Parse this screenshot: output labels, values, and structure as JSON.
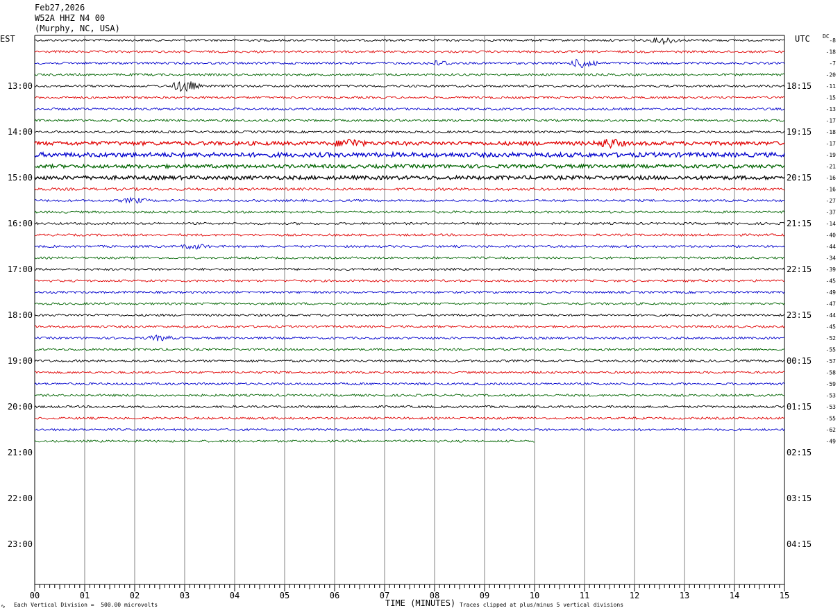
{
  "header": {
    "date": "Feb27,2026",
    "station": "W52A HHZ N4 00",
    "location": "(Murphy, NC, USA)"
  },
  "labels": {
    "left_tz": "EST",
    "right_tz": "UTC",
    "dc": "DC",
    "xlabel": "TIME (MINUTES)",
    "scale_note": "Each Vertical Division =  500.00 microvolts",
    "clip_note": "Traces clipped at plus/minus 5 vertical divisions",
    "corner_mark": "∿"
  },
  "chart_data": {
    "type": "line",
    "title": "W52A HHZ N4 00",
    "xlabel": "TIME (MINUTES)",
    "ylabel": "",
    "x_range": [
      0,
      15
    ],
    "x_ticks": [
      "00",
      "01",
      "02",
      "03",
      "04",
      "05",
      "06",
      "07",
      "08",
      "09",
      "10",
      "11",
      "12",
      "13",
      "14",
      "15"
    ],
    "lines_per_hour": 4,
    "total_lines": 48,
    "left_hour_labels": [
      "13:00",
      "14:00",
      "15:00",
      "16:00",
      "17:00",
      "18:00",
      "19:00",
      "20:00",
      "21:00",
      "22:00",
      "23:00"
    ],
    "right_hour_labels": [
      "18:15",
      "19:15",
      "20:15",
      "21:15",
      "22:15",
      "23:15",
      "00:15",
      "01:15",
      "02:15",
      "03:15",
      "04:15"
    ],
    "trace_colors": [
      "#000000",
      "#e00000",
      "#0000cc",
      "#006400"
    ],
    "dc_offsets": [
      -8,
      -18,
      -7,
      -20,
      -11,
      -15,
      -13,
      -17,
      -18,
      -17,
      -19,
      -21,
      -16,
      -16,
      -27,
      -37,
      -14,
      -40,
      -44,
      -34,
      -39,
      -45,
      -49,
      -47,
      -44,
      -45,
      -52,
      -55,
      -57,
      -58,
      -59,
      -53,
      -53,
      -55,
      -62,
      -49
    ],
    "traces_recorded": 36,
    "last_trace_end_minute": 10,
    "noise_levels": [
      1,
      1,
      1,
      1,
      1,
      1,
      1,
      1,
      1,
      1.7,
      2,
      1.6,
      1.7,
      1.2,
      1,
      1,
      1,
      1,
      1,
      1,
      1,
      1,
      1,
      1,
      1,
      1,
      1,
      1,
      1,
      1,
      1,
      1,
      1,
      1,
      1,
      1
    ],
    "events": [
      {
        "trace": 0,
        "minute": 12.6,
        "amp": 2
      },
      {
        "trace": 2,
        "minute": 11.0,
        "amp": 3.5
      },
      {
        "trace": 2,
        "minute": 8.1,
        "amp": 1.5
      },
      {
        "trace": 4,
        "minute": 3.0,
        "amp": 4
      },
      {
        "trace": 9,
        "minute": 6.3,
        "amp": 2.5
      },
      {
        "trace": 9,
        "minute": 11.5,
        "amp": 2.5
      },
      {
        "trace": 14,
        "minute": 2.0,
        "amp": 1.5
      },
      {
        "trace": 18,
        "minute": 3.2,
        "amp": 1.5
      },
      {
        "trace": 26,
        "minute": 2.5,
        "amp": 1.5
      }
    ],
    "grid": true
  }
}
